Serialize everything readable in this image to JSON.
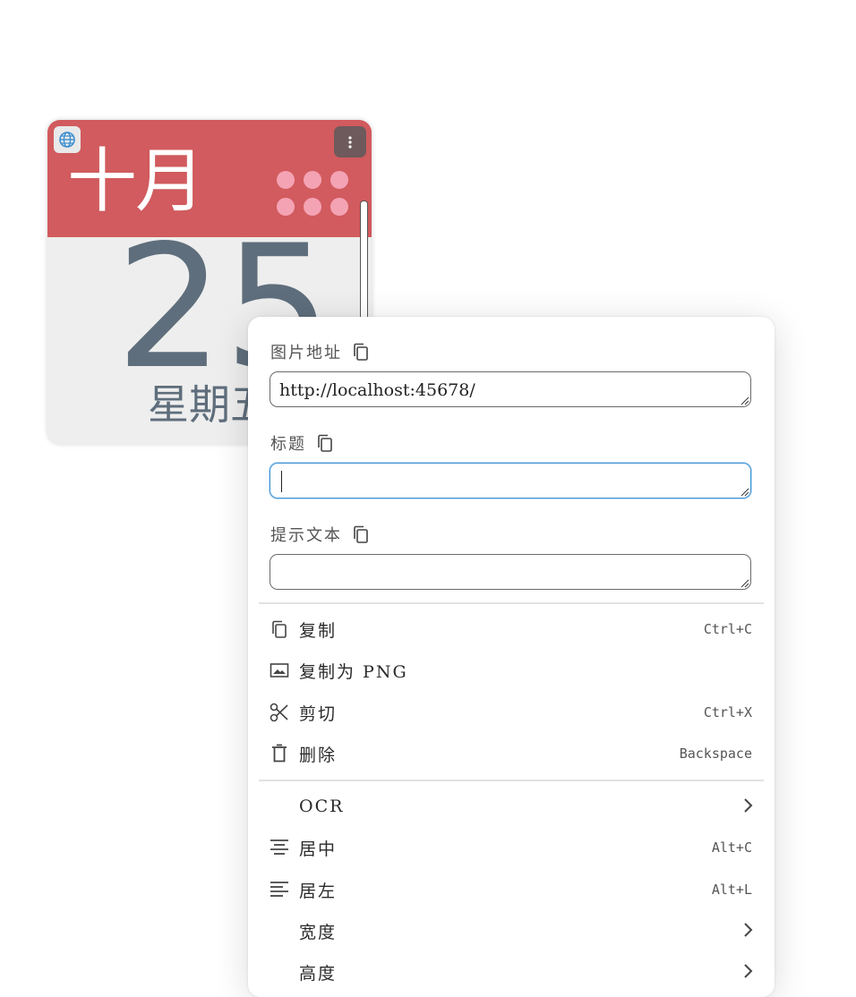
{
  "calendar": {
    "month": "十月",
    "day": "25",
    "weekday": "星期五",
    "colors": {
      "header": "#d15b5e",
      "dots": "#f4a3b4",
      "digits": "#5f6e7c"
    }
  },
  "menu": {
    "fields": {
      "image_url_label": "图片地址",
      "image_url_value": "http://localhost:45678/",
      "title_label": "标题",
      "title_value": "",
      "alt_label": "提示文本",
      "alt_value": ""
    },
    "items": [
      {
        "label": "复制",
        "shortcut": "Ctrl+C",
        "icon": "copy-icon"
      },
      {
        "label": "复制为 PNG",
        "shortcut": "",
        "icon": "image-icon"
      },
      {
        "label": "剪切",
        "shortcut": "Ctrl+X",
        "icon": "scissors-icon"
      },
      {
        "label": "删除",
        "shortcut": "Backspace",
        "icon": "trash-icon"
      },
      {
        "label": "OCR",
        "shortcut": "",
        "icon": "",
        "submenu": true
      },
      {
        "label": "居中",
        "shortcut": "Alt+C",
        "icon": "align-center-icon"
      },
      {
        "label": "居左",
        "shortcut": "Alt+L",
        "icon": "align-left-icon"
      },
      {
        "label": "宽度",
        "shortcut": "",
        "icon": "",
        "submenu": true
      },
      {
        "label": "高度",
        "shortcut": "",
        "icon": "",
        "submenu": true
      }
    ]
  }
}
